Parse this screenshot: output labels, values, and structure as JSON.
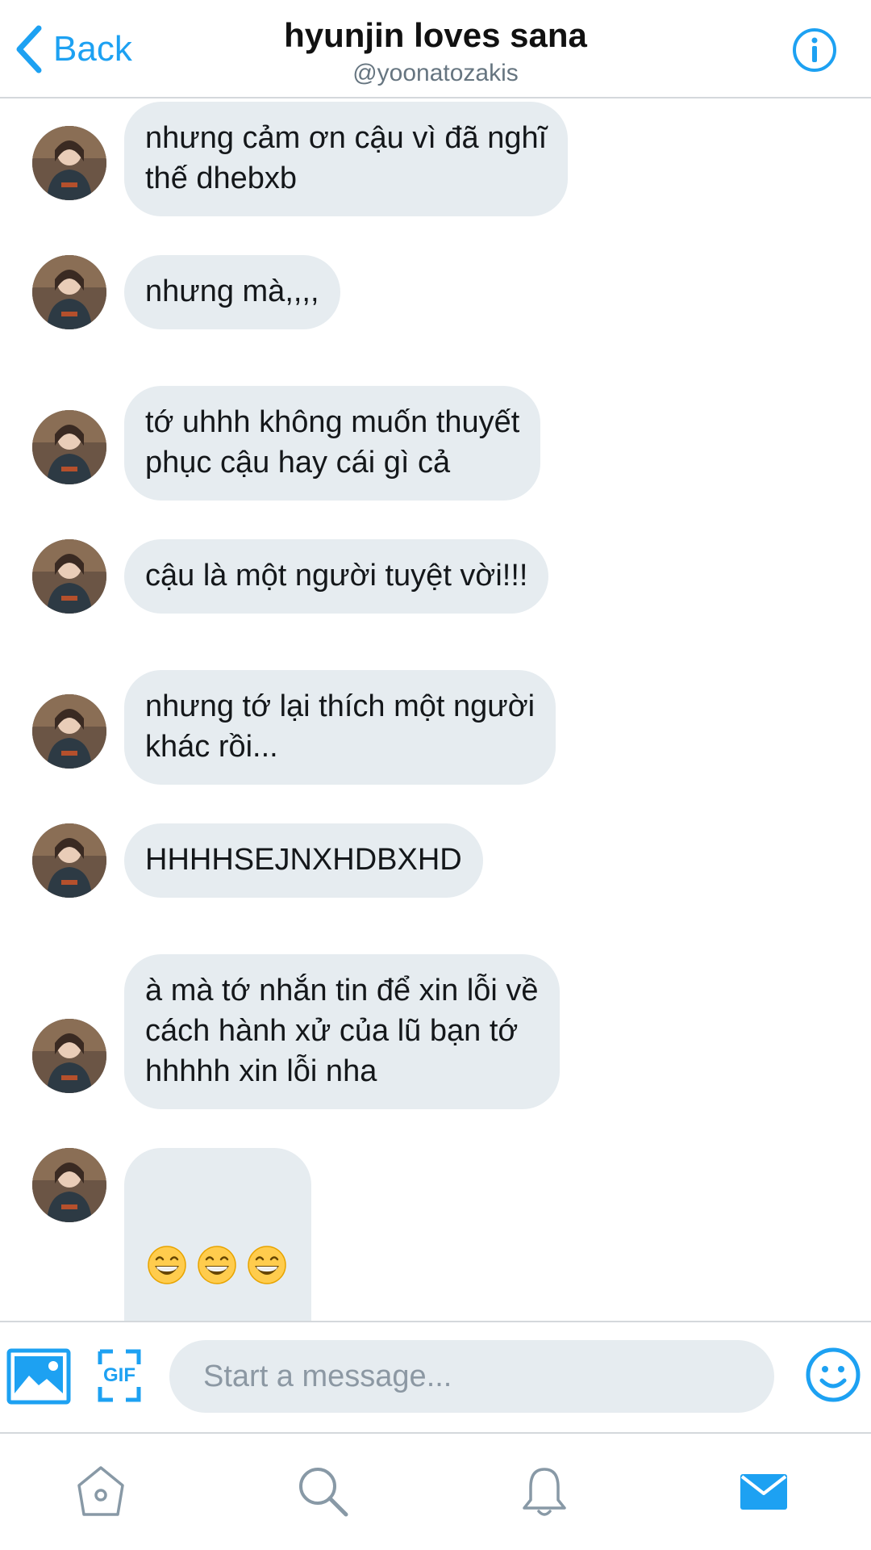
{
  "header": {
    "back_label": "Back",
    "title": "hyunjin loves sana",
    "handle": "@yoonatozakis"
  },
  "messages": [
    {
      "text": "nhưng cảm ơn cậu vì đã nghĩ\nthế dhebxb"
    },
    {
      "text": "nhưng mà,,,,"
    },
    {
      "text": "tớ uhhh không muốn thuyết\nphục cậu hay cái gì cả"
    },
    {
      "text": "cậu là một người tuyệt vời!!!"
    },
    {
      "text": "nhưng tớ lại thích một người\nkhác rồi..."
    },
    {
      "text": "HHHHSEJNXHDBXHD"
    },
    {
      "text": "à mà tớ nhắn tin để xin lỗi về\ncách hành xử của lũ bạn tớ\nhhhhh xin lỗi nha"
    },
    {
      "emoji": [
        "grinning-face-with-smiling-eyes",
        "grinning-face-with-smiling-eyes",
        "grinning-face-with-smiling-eyes"
      ]
    }
  ],
  "composer": {
    "placeholder": "Start a message...",
    "gif_label": "GIF"
  },
  "tabs": [
    {
      "icon": "home-icon",
      "active": false
    },
    {
      "icon": "search-icon",
      "active": false
    },
    {
      "icon": "bell-icon",
      "active": false
    },
    {
      "icon": "mail-icon",
      "active": true
    }
  ],
  "colors": {
    "accent": "#1da1f2",
    "bubble": "#e6ecf0",
    "divider": "#d4d8dc",
    "inactive_icon": "#8899a6"
  }
}
